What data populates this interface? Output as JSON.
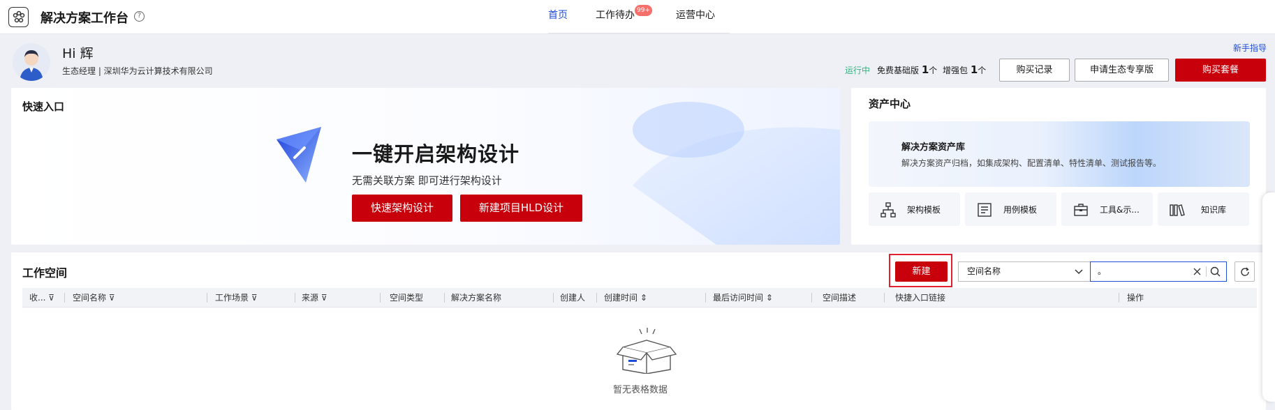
{
  "app": {
    "title": "解决方案工作台"
  },
  "nav": {
    "home": "首页",
    "todo": "工作待办",
    "todo_badge": "99+",
    "ops": "运营中心"
  },
  "profile": {
    "greeting": "Hi 辉",
    "role": "生态经理 | 深圳华为云计算技术有限公司",
    "guide_link": "新手指导",
    "status": "运行中",
    "free_label": "免费基础版",
    "free_count": "1",
    "free_unit": "个",
    "plus_label": "增强包",
    "plus_count": "1",
    "plus_unit": "个",
    "btn_records": "购买记录",
    "btn_apply": "申请生态专享版",
    "btn_buy": "购买套餐"
  },
  "quick": {
    "title": "快速入口",
    "hero_title": "一键开启架构设计",
    "hero_sub": "无需关联方案 即可进行架构设计",
    "btn_fast": "快速架构设计",
    "btn_hld": "新建项目HLD设计"
  },
  "asset": {
    "title": "资产中心",
    "banner_title": "解决方案资产库",
    "banner_desc": "解决方案资产归档，如集成架构、配置清单、特性清单、测试报告等。",
    "tiles": [
      "架构模板",
      "用例模板",
      "工具&示...",
      "知识库"
    ]
  },
  "workspace": {
    "title": "工作空间",
    "new_btn": "新建",
    "select_value": "空间名称",
    "search_value": "。",
    "columns": [
      "收...",
      "空间名称",
      "工作场景",
      "来源",
      "空间类型",
      "解决方案名称",
      "创建人",
      "创建时间",
      "最后访问时间",
      "空间描述",
      "快捷入口链接",
      "操作"
    ],
    "empty_text": "暂无表格数据"
  },
  "colors": {
    "brand_red": "#c7000b",
    "link_blue": "#1e4cd8",
    "running_green": "#36b37e"
  }
}
